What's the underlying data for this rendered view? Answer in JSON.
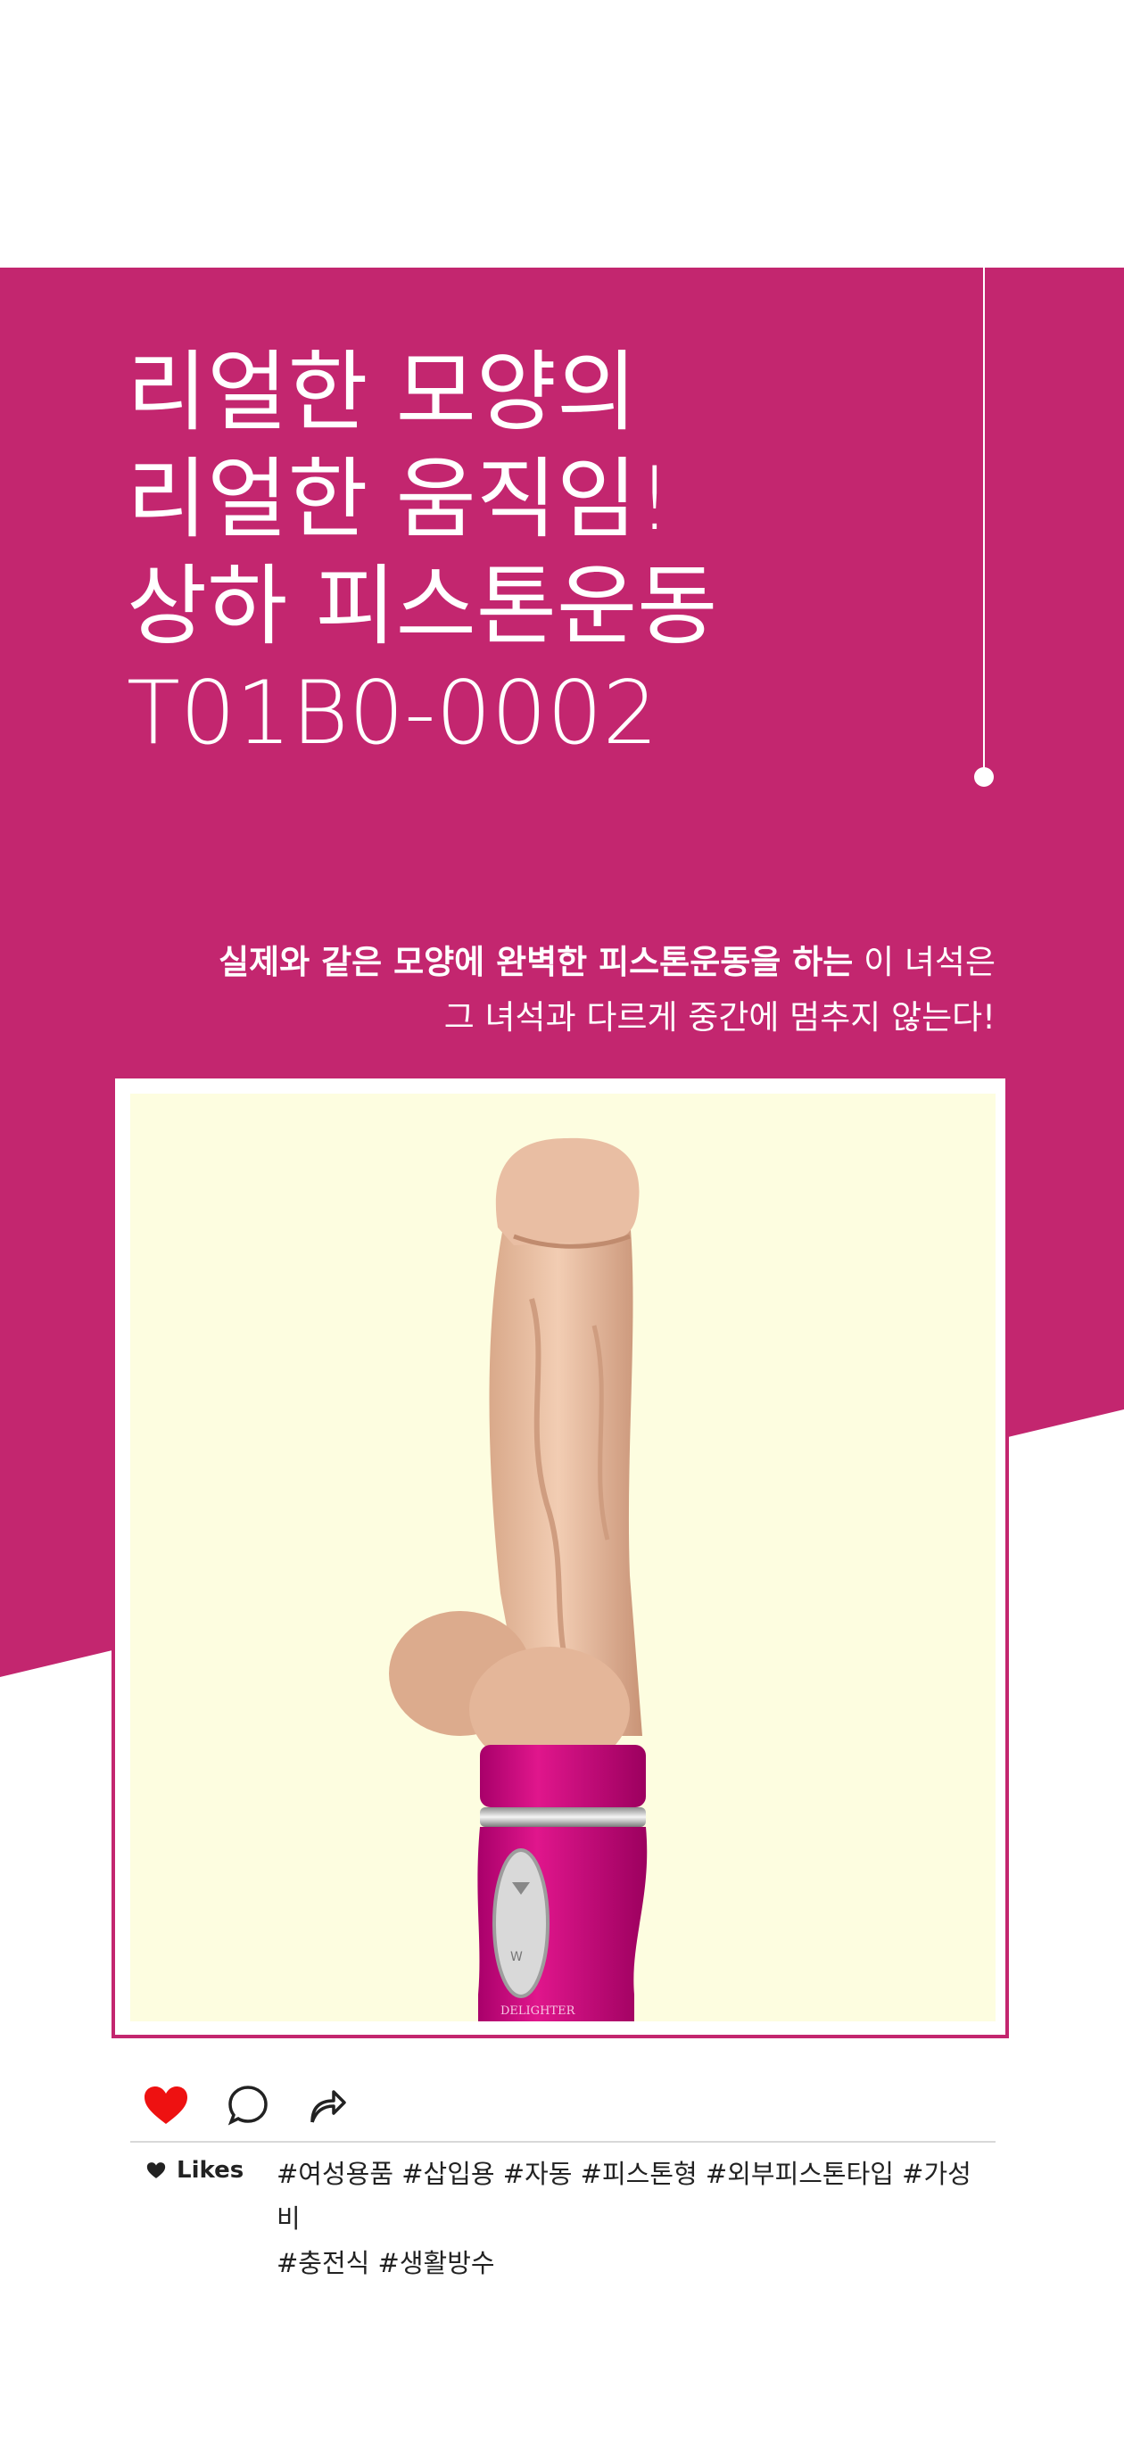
{
  "colors": {
    "brand": "#c3266f",
    "photo_bg": "#fdfde0",
    "heart": "#ee1111",
    "text_dark": "#222222"
  },
  "headline": {
    "lines": [
      "리얼한 모양의",
      "리얼한 움직임!",
      "상하 피스톤운동",
      "T01B0-0002"
    ]
  },
  "description": {
    "line1_bold": "실제와 같은 모양에 완벽한 피스톤운동을 하는",
    "line1_regular": " 이 녀석은",
    "line2": "그 녀석과 다르게 중간에 멈추지 않는다!"
  },
  "product_image": {
    "brand_text": "DELIGHTER"
  },
  "social": {
    "icons": [
      "heart-icon",
      "comment-icon",
      "share-icon"
    ],
    "likes_label": "Likes",
    "tags_line1": "#여성용품 #삽입용 #자동 #피스톤형 #외부피스톤타입 #가성비",
    "tags_line2": "#충전식 #생활방수"
  }
}
